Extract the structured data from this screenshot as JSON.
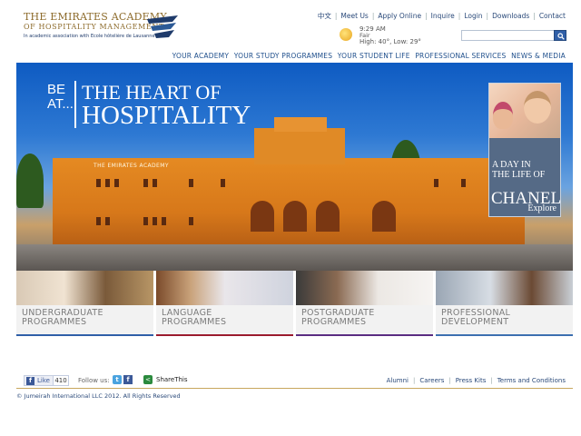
{
  "logo": {
    "line1": "THE EMIRATES ACADEMY",
    "line2": "OF HOSPITALITY MANAGEMENT",
    "line3": "In academic association with Ecole hôtelière de Lausanne"
  },
  "top_links": [
    "中文",
    "Meet Us",
    "Apply Online",
    "Inquire",
    "Login",
    "Downloads",
    "Contact"
  ],
  "weather": {
    "time": "9:29 AM",
    "condition": "Fair",
    "temps": "High: 40°, Low: 29°",
    "icon": "sun-icon"
  },
  "search": {
    "placeholder": "",
    "value": ""
  },
  "main_nav": [
    "YOUR ACADEMY",
    "YOUR STUDY PROGRAMMES",
    "YOUR STUDENT LIFE",
    "PROFESSIONAL SERVICES",
    "NEWS & MEDIA"
  ],
  "hero": {
    "be": "BE",
    "at": "AT...",
    "title_line1": "THE HEART OF",
    "title_line2": "HOSPITALITY",
    "building_sign": "THE EMIRATES ACADEMY"
  },
  "promo": {
    "line1": "A DAY IN",
    "line2": "THE LIFE OF",
    "name": "CHANEL",
    "cta": "Explore"
  },
  "tiles": [
    {
      "line1": "UNDERGRADUATE",
      "line2": "PROGRAMMES",
      "accent": "#2f5fa8"
    },
    {
      "line1": "LANGUAGE",
      "line2": "PROGRAMMES",
      "accent": "#9b1b2e"
    },
    {
      "line1": "POSTGRADUATE",
      "line2": "PROGRAMMES",
      "accent": "#5a2d82"
    },
    {
      "line1": "PROFESSIONAL",
      "line2": "DEVELOPMENT",
      "accent": "#3d6fb0"
    }
  ],
  "footer": {
    "like_label": "Like",
    "like_count": "410",
    "follow_label": "Follow us:",
    "share_label": "ShareThis",
    "links": [
      "Alumni",
      "Careers",
      "Press Kits",
      "Terms and Conditions"
    ],
    "copyright": "© Jumeirah International LLC 2012.  All Rights Reserved"
  },
  "colors": {
    "brand_gold": "#8c6a2a",
    "brand_blue": "#1f4f8c"
  }
}
